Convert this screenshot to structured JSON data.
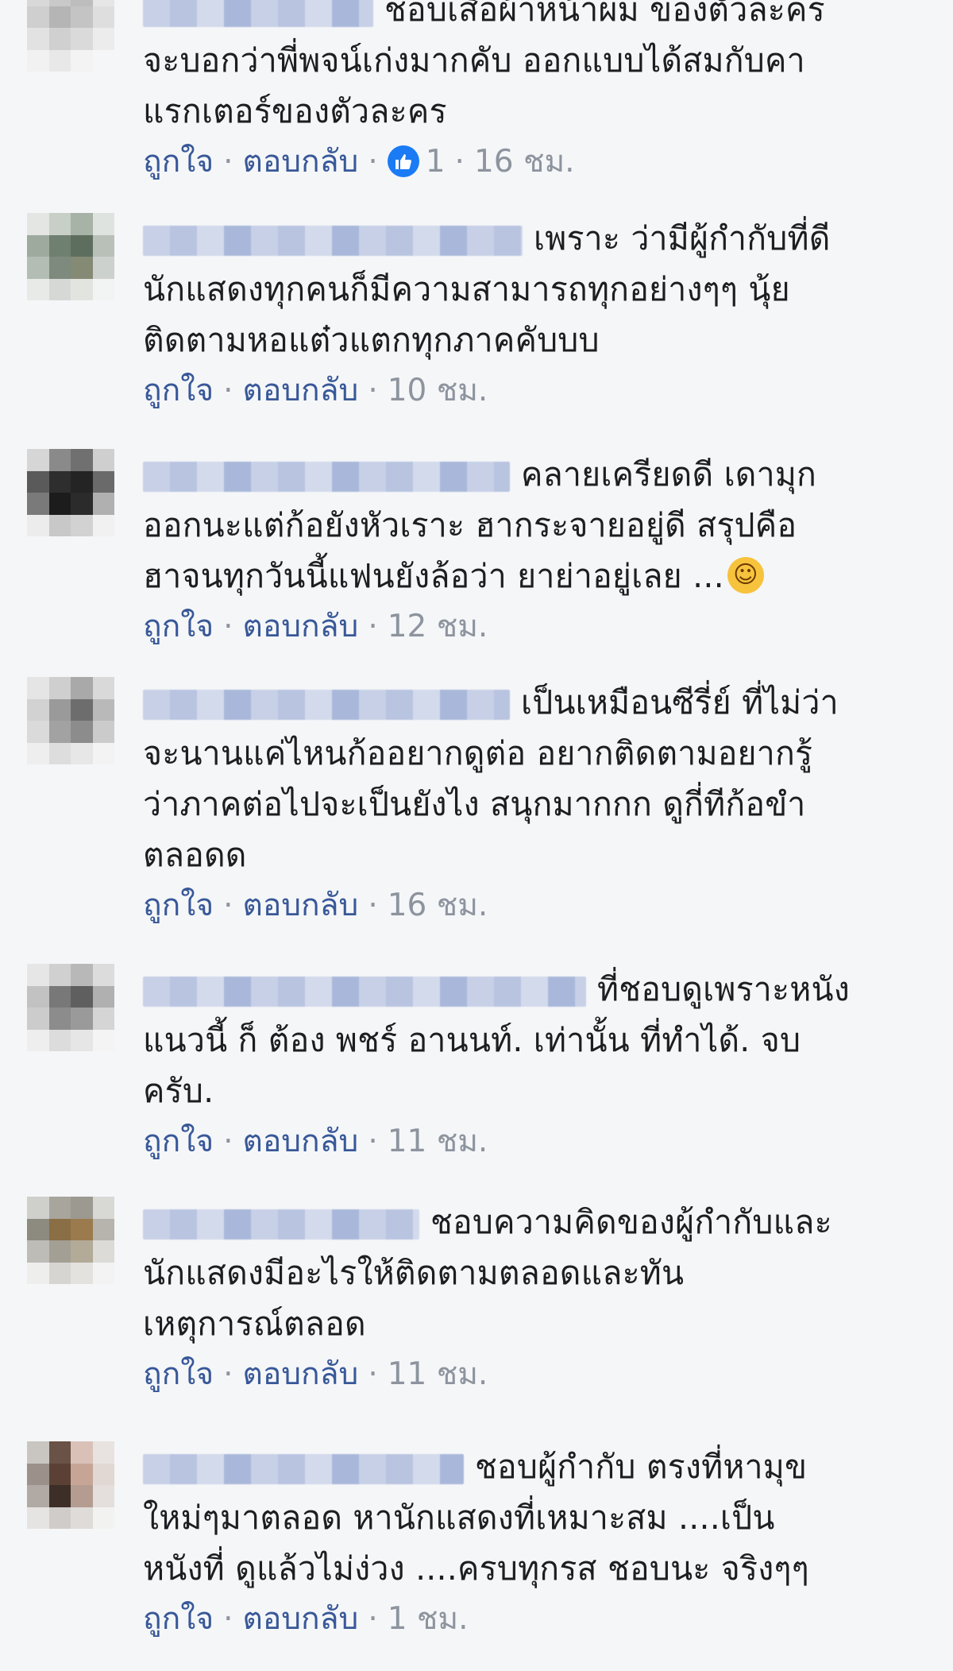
{
  "actions": {
    "like": "ถูกใจ",
    "reply": "ตอบกลับ",
    "separator": "·"
  },
  "emoji_icon": "rolling-on-floor-laughing-emoji",
  "comments": [
    {
      "lines": [
        "ชอบเสื้อผ้าหน้าผม ของตัวละคร",
        "จะบอกว่าพี่พจน์เก่งมากคับ ออกแบบได้สมกับคา",
        "แรกเตอร์ของตัวละคร"
      ],
      "reactions": "1",
      "time": "16 ชม."
    },
    {
      "lines": [
        "เพราะ ว่ามีผู้กำกับที่ดี",
        "นักแสดงทุกคนก็มีความสามารถทุกอย่างๆๆ นุ้ย",
        "ติดตามหอแต๋วแตกทุกภาคคับบบ"
      ],
      "time": "10 ชม."
    },
    {
      "lines": [
        "คลายเครียดดี เดามุก",
        "ออกนะแต่ก้อยังหัวเราะ ฮากระจายอยู่ดี สรุปคือ",
        "ฮาจนทุกวันนี้แฟนยังล้อว่า ยาย่าอยู่เลย ..."
      ],
      "time": "12 ชม."
    },
    {
      "lines": [
        "เป็นเหมือนซีรี่ย์ ที่ไม่ว่า",
        "จะนานแค่ไหนก้ออยากดูต่อ อยากติดตามอยากรู้",
        "ว่าภาคต่อไปจะเป็นยังไง สนุกมากกก ดูกี่ทีก้อขำ",
        "ตลอดด"
      ],
      "time": "16 ชม."
    },
    {
      "lines": [
        "ที่ชอบดูเพราะหนัง",
        "แนวนี้ ก็ ต้อง พชร์ อานนท์. เท่านั้น ที่ทำได้. จบ",
        "ครับ."
      ],
      "time": "11 ชม."
    },
    {
      "lines": [
        "ชอบความคิดของผู้กำกับและ",
        "นักแสดงมีอะไรให้ติดตามตลอดและทัน",
        "เหตุการณ์ตลอด"
      ],
      "time": "11 ชม."
    },
    {
      "lines": [
        "ชอบผู้กำกับ ตรงที่หามุข",
        "ใหม่ๆมาตลอด หานักแสดงที่เหมาะสม ....เป็น",
        "หนังที่ ดูแล้วไม่ง่วง ....ครบทุกรส ชอบนะ จริงๆๆ"
      ],
      "time": "1 ชม."
    }
  ]
}
